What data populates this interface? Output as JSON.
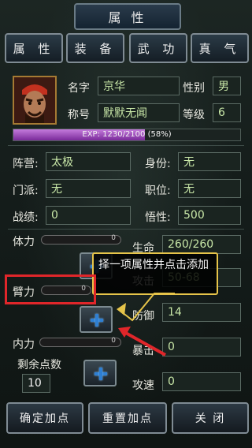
{
  "title": "属 性",
  "tabs": [
    "属 性",
    "装 备",
    "武 功",
    "真 气"
  ],
  "profile": {
    "name_label": "名字",
    "name_value": "京华",
    "gender_label": "性别",
    "gender_value": "男",
    "nickname_label": "称号",
    "nickname_value": "默默无闻",
    "level_label": "等级",
    "level_value": "6",
    "exp_text": "EXP: 1230/2100  (58%)",
    "exp_fraction": 0.58
  },
  "info": {
    "faction_label": "阵营:",
    "faction_value": "太极",
    "identity_label": "身份:",
    "identity_value": "无",
    "sect_label": "门派:",
    "sect_value": "无",
    "position_label": "职位:",
    "position_value": "无",
    "achievement_label": "战绩:",
    "achievement_value": "0",
    "insight_label": "悟性:",
    "insight_value": "500"
  },
  "attributes": {
    "stamina_label": "体力",
    "stamina_value": "0",
    "arm_label": "臂力",
    "arm_value": "0",
    "inner_label": "内力",
    "inner_value": "0",
    "remaining_label": "剩余点数",
    "remaining_value": "10"
  },
  "stats": {
    "hp_label": "生命",
    "hp_value": "260/260",
    "attack_label": "攻击",
    "attack_value": "50-68",
    "defense_label": "防御",
    "defense_value": "14",
    "crit_label": "暴击",
    "crit_value": "0",
    "speed_label": "攻速",
    "speed_value": "0"
  },
  "tooltip": "择一项属性并点击添加",
  "buttons": {
    "confirm": "确定加点",
    "reset": "重置加点",
    "close": "关 闭"
  },
  "colors": {
    "exp_fill": "#9d4fc0",
    "highlight_red": "#e0262a",
    "tooltip_border": "#e6c44a",
    "plus_blue": "#2f7fd2"
  }
}
